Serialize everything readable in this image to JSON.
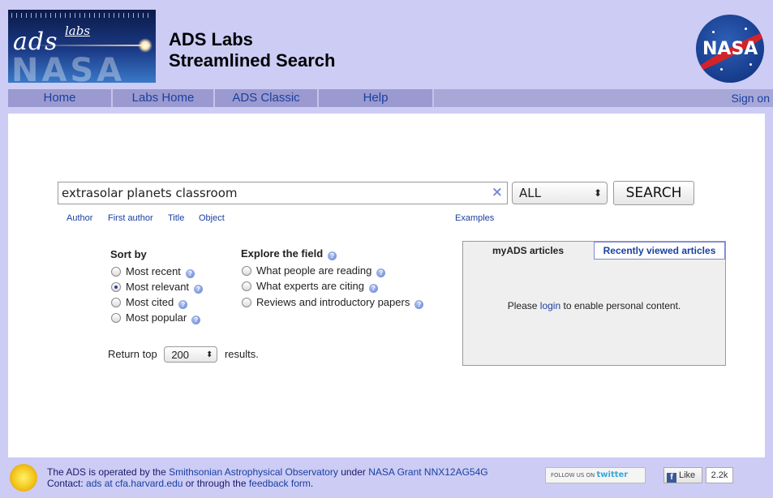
{
  "header": {
    "logo_ads": "ads",
    "logo_labs": "labs",
    "title_line1": "ADS Labs",
    "title_line2": "Streamlined Search",
    "nasa_logo_text": "NASA"
  },
  "nav": {
    "items": [
      {
        "label": "Home"
      },
      {
        "label": "Labs Home"
      },
      {
        "label": "ADS Classic"
      },
      {
        "label": "Help"
      }
    ],
    "sign_on": "Sign on"
  },
  "search": {
    "query": "extrasolar planets classroom",
    "clear_icon": "×",
    "scope_selected": "ALL",
    "button_label": "SEARCH",
    "field_links": [
      "Author",
      "First author",
      "Title",
      "Object"
    ],
    "examples_link": "Examples"
  },
  "sort": {
    "title": "Sort by",
    "options": [
      {
        "label": "Most recent",
        "selected": false
      },
      {
        "label": "Most relevant",
        "selected": true
      },
      {
        "label": "Most cited",
        "selected": false
      },
      {
        "label": "Most popular",
        "selected": false
      }
    ]
  },
  "explore": {
    "title": "Explore the field",
    "options": [
      {
        "label": "What people are reading"
      },
      {
        "label": "What experts are citing"
      },
      {
        "label": "Reviews and introductory papers"
      }
    ]
  },
  "results": {
    "prefix": "Return top",
    "count": "200",
    "suffix": "results."
  },
  "panel": {
    "tab_myads": "myADS articles",
    "tab_recent": "Recently viewed articles",
    "msg_before": "Please",
    "msg_link": "login",
    "msg_after": "to enable personal content."
  },
  "footer": {
    "line1_a": "The ADS is operated by the ",
    "line1_link1": "Smithsonian Astrophysical Observatory",
    "line1_b": " under ",
    "line1_link2": "NASA Grant NNX12AG54G",
    "line2_a": "Contact: ",
    "line2_link1": "ads at cfa.harvard.edu",
    "line2_b": " or through the ",
    "line2_link2": "feedback form",
    "line2_c": ".",
    "twitter_prefix": "FOLLOW US ON",
    "twitter_brand": "twitter",
    "fb_like": "Like",
    "fb_count": "2.2k"
  },
  "colors": {
    "frame": "#ccccf5",
    "nav": "#a8a8d8",
    "link": "#1a3fa0"
  }
}
